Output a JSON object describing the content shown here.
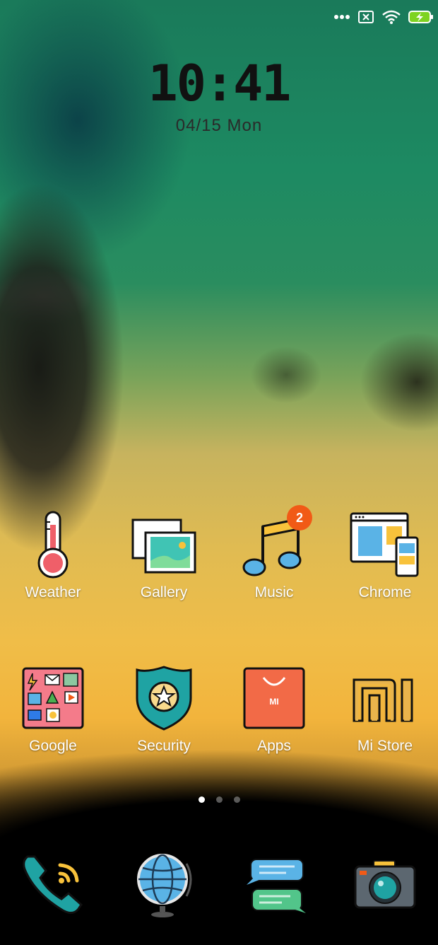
{
  "status_bar": {
    "icons": [
      "more-dots-icon",
      "sim-off-icon",
      "wifi-icon",
      "battery-charging-icon"
    ]
  },
  "lock_clock": {
    "time": "10:41",
    "date": "04/15  Mon"
  },
  "home_row_1": [
    {
      "label": "Weather",
      "icon": "thermometer-icon"
    },
    {
      "label": "Gallery",
      "icon": "gallery-icon"
    },
    {
      "label": "Music",
      "icon": "music-note-icon",
      "badge": "2"
    },
    {
      "label": "Chrome",
      "icon": "browser-icon"
    }
  ],
  "home_row_2": [
    {
      "label": "Google",
      "icon": "google-folder-icon"
    },
    {
      "label": "Security",
      "icon": "shield-star-icon"
    },
    {
      "label": "Apps",
      "icon": "shopping-bag-icon"
    },
    {
      "label": "Mi Store",
      "icon": "mi-logo-icon"
    }
  ],
  "page_indicator": {
    "pages": 3,
    "current": 1
  },
  "dock": [
    {
      "icon": "phone-icon"
    },
    {
      "icon": "globe-icon"
    },
    {
      "icon": "messages-icon"
    },
    {
      "icon": "camera-icon"
    }
  ],
  "colors": {
    "badge": "#f15a16",
    "apps_bag": "#f26a47",
    "security_shield": "#1fa3a3",
    "mi_store": "#e9b44c"
  }
}
